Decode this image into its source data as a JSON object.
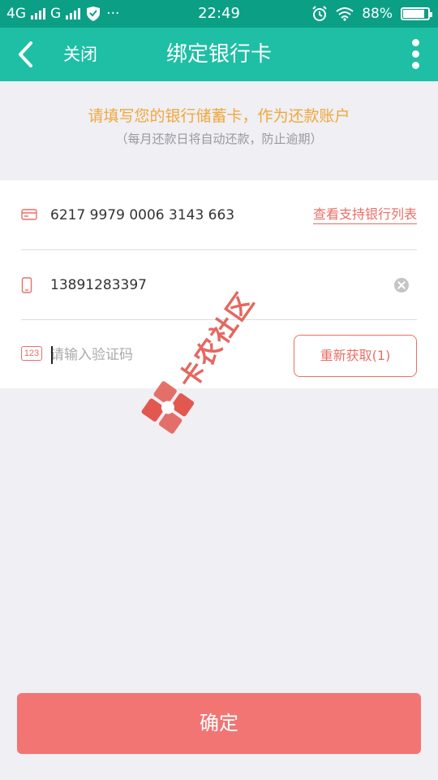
{
  "status_bar": {
    "net1": "4G",
    "net2": "G",
    "more": "···",
    "time": "22:49",
    "battery": "88%",
    "battery_level": 0.88
  },
  "nav": {
    "close_label": "关闭",
    "title": "绑定银行卡"
  },
  "hint": {
    "main": "请填写您的银行储蓄卡，作为还款账户",
    "sub": "（每月还款日将自动还款，防止逾期）"
  },
  "form": {
    "card_number": "6217 9979 0006 3143 663",
    "bank_list_link": "查看支持银行列表",
    "phone": "13891283397",
    "code_placeholder": "请输入验证码",
    "code_icon_text": "123",
    "resend_label": "重新获取(1)"
  },
  "watermark": {
    "text": "卡农社区"
  },
  "confirm_label": "确定",
  "colors": {
    "status_bar": "#0b9f86",
    "nav_bar": "#1ebfa5",
    "hint": "#f0a73a",
    "accent": "#e96f67",
    "confirm": "#f27573"
  }
}
